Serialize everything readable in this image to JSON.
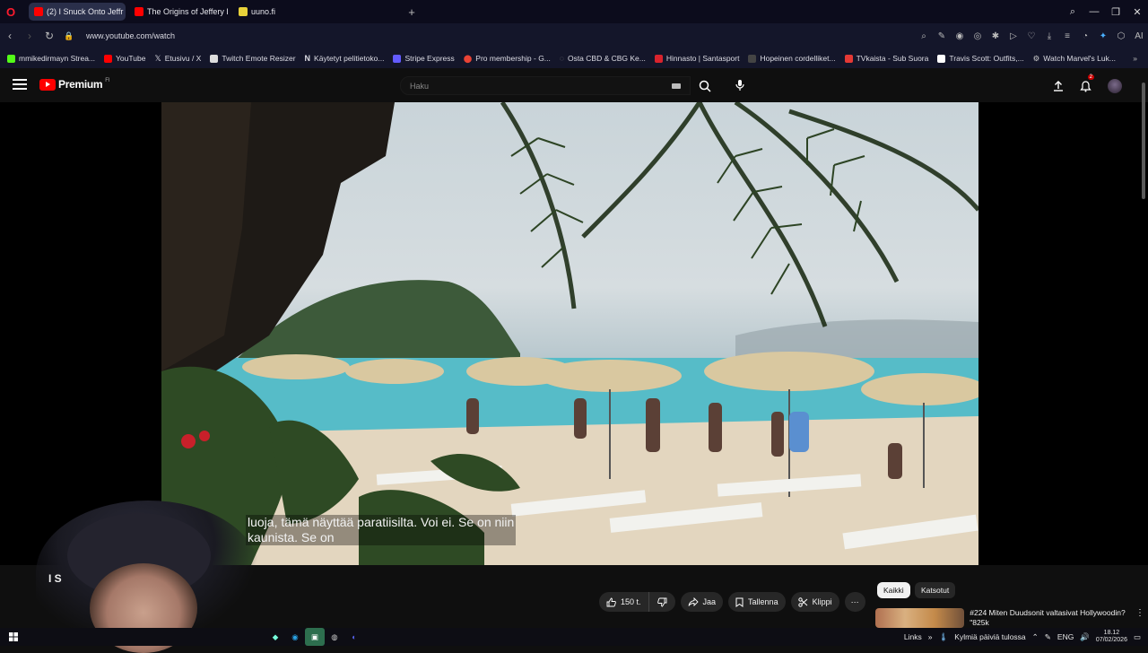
{
  "browser": {
    "tabs": [
      {
        "title": "(2) I Snuck Onto Jeffr",
        "active": true,
        "favicon_color": "#ff0000"
      },
      {
        "title": "The Origins of Jeffery Eps",
        "active": false,
        "favicon_color": "#ff0000"
      },
      {
        "title": "uuno.fi",
        "active": false,
        "favicon_color": "#e8d23a"
      }
    ],
    "new_tab": "+",
    "url": "www.youtube.com/watch",
    "bookmarks": [
      {
        "label": "mmikedirmayn Strea...",
        "icon_color": "#53fc18"
      },
      {
        "label": "YouTube",
        "icon_color": "#ff0000"
      },
      {
        "label": "Etusivu / X",
        "icon_color": "#ffffff"
      },
      {
        "label": "Twitch Emote Resizer",
        "icon_color": "#dddddd"
      },
      {
        "label": "Käytetyt pelitietoko...",
        "icon_color": "#ffffff"
      },
      {
        "label": "Stripe Express",
        "icon_color": "#635bff"
      },
      {
        "label": "Pro membership - G...",
        "icon_color": "#ea4335"
      },
      {
        "label": "Osta CBD & CBG Ke...",
        "icon_color": "#888888"
      },
      {
        "label": "Hinnasto | Santasport",
        "icon_color": "#d9232d"
      },
      {
        "label": "Hopeinen cordelliket...",
        "icon_color": "#444444"
      },
      {
        "label": "TVkaista - Sub Suora",
        "icon_color": "#e53935"
      },
      {
        "label": "Travis Scott: Outfits,...",
        "icon_color": "#ffffff"
      },
      {
        "label": "Watch Marvel's Luk...",
        "icon_color": "#cccccc"
      }
    ]
  },
  "youtube": {
    "logo_text": "Premium",
    "logo_region": "FI",
    "search_placeholder": "Haku",
    "notification_count": "2",
    "caption_lines": [
      "luoja, tämä näyttää paratiisilta.  Voi ei.  Se on niin",
      "kaunista.   Se on"
    ],
    "video_title_fragment": "I S",
    "actions": {
      "like_count": "150 t.",
      "share_label": "Jaa",
      "save_label": "Tallenna",
      "clip_label": "Klippi",
      "more": "⋯"
    },
    "chips": [
      {
        "label": "Kaikki",
        "selected": true
      },
      {
        "label": "Katsotut",
        "selected": false
      }
    ],
    "recommendation": {
      "title": "#224 Miten Duudsonit valtasivat Hollywoodin? \"825k"
    }
  },
  "taskbar": {
    "links_label": "Links",
    "weather": "Kylmiä päiviä tulossa",
    "language": "ENG",
    "time": "18.12",
    "date": "07/02/2026"
  },
  "colors": {
    "yt_red": "#ff0000",
    "bg": "#0f0f0f",
    "pill_bg": "#272727"
  }
}
